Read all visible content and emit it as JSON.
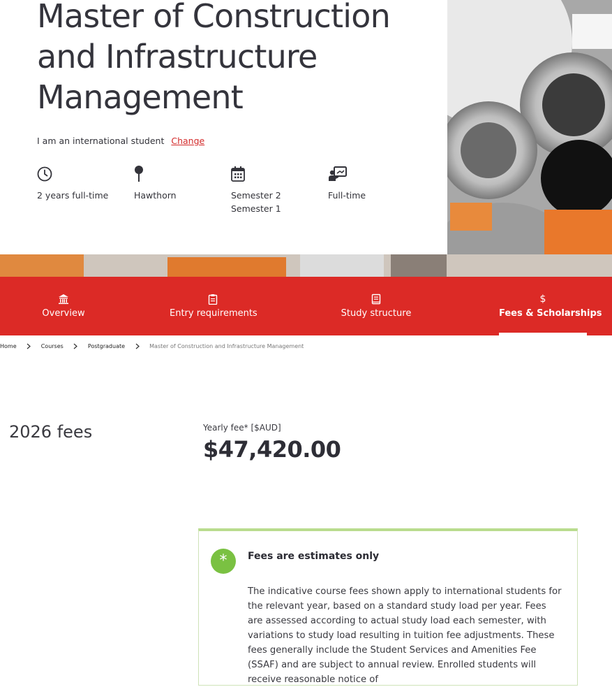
{
  "hero": {
    "title": "Master of Construction and Infrastructure Management",
    "student_type_text": "I am an international student",
    "change_link": "Change",
    "facts": [
      {
        "icon": "clock-icon",
        "lines": [
          "2 years full-time"
        ]
      },
      {
        "icon": "map-pin-icon",
        "lines": [
          "Hawthorn"
        ]
      },
      {
        "icon": "calendar-icon",
        "lines": [
          "Semester 2",
          "Semester 1"
        ]
      },
      {
        "icon": "presentation-icon",
        "lines": [
          "Full-time"
        ]
      }
    ]
  },
  "tabs": [
    {
      "label": "Overview",
      "icon": "institution-icon",
      "active": false
    },
    {
      "label": "Entry requirements",
      "icon": "clipboard-icon",
      "active": false
    },
    {
      "label": "Study structure",
      "icon": "book-icon",
      "active": false
    },
    {
      "label": "Fees & Scholarships",
      "icon": "dollar-icon",
      "active": true
    }
  ],
  "breadcrumb": [
    "Home",
    "Courses",
    "Postgraduate",
    "Master of Construction and Infrastructure Management"
  ],
  "fees": {
    "heading": "2026 fees",
    "label": "Yearly fee* [$AUD]",
    "amount": "$47,420.00"
  },
  "notice": {
    "icon": "asterisk-icon",
    "title": "Fees are estimates only",
    "body": "The indicative course fees shown apply to international students for the relevant year, based on a standard study load per year. Fees are assessed according to actual study load each semester, with variations to study load resulting in tuition fee adjustments. These fees generally include the Student Services and Amenities Fee (SSAF) and are subject to annual review. Enrolled students will receive reasonable notice of"
  },
  "colors": {
    "brand_red": "#dc2a26",
    "notice_green": "#7ac142",
    "notice_border": "#b9dc8e",
    "link_red": "#d32b2b"
  }
}
